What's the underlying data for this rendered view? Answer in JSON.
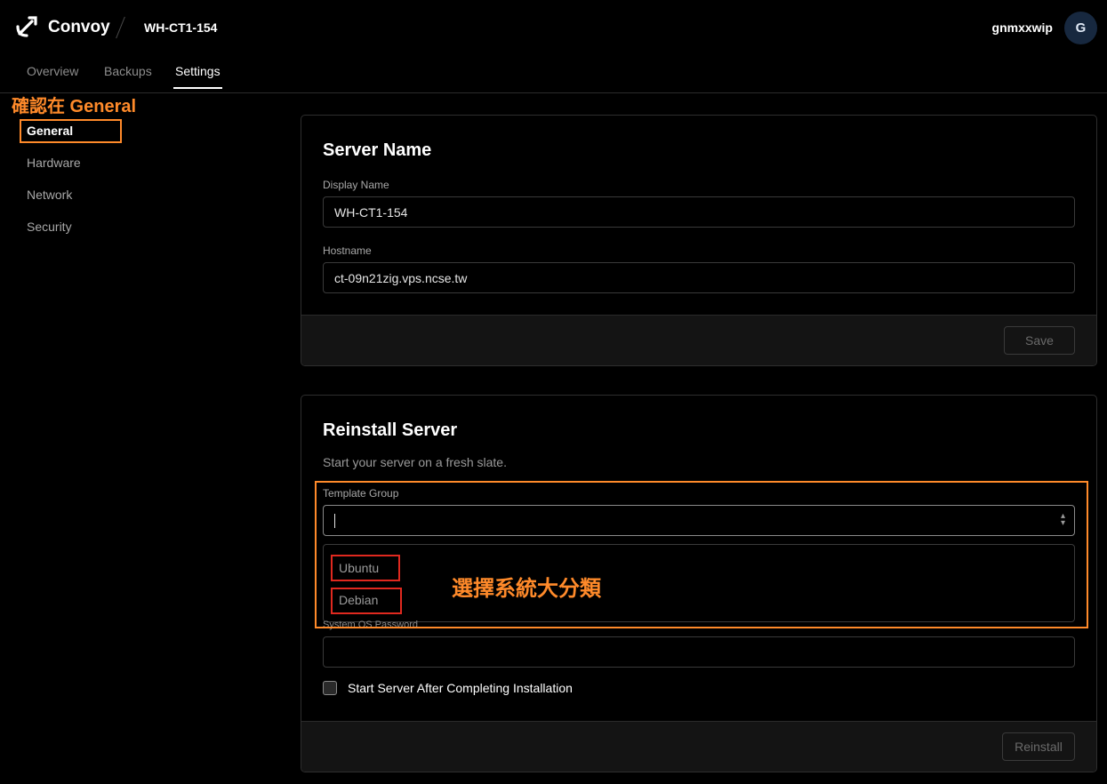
{
  "header": {
    "brand": "Convoy",
    "server_name": "WH-CT1-154",
    "username": "gnmxxwip",
    "avatar_initial": "G"
  },
  "tabs": [
    {
      "label": "Overview",
      "active": false
    },
    {
      "label": "Backups",
      "active": false
    },
    {
      "label": "Settings",
      "active": true
    }
  ],
  "sidebar": {
    "annotation": "確認在 General",
    "items": [
      {
        "label": "General",
        "active": true
      },
      {
        "label": "Hardware",
        "active": false
      },
      {
        "label": "Network",
        "active": false
      },
      {
        "label": "Security",
        "active": false
      }
    ]
  },
  "server_name_card": {
    "title": "Server Name",
    "display_name_label": "Display Name",
    "display_name_value": "WH-CT1-154",
    "hostname_label": "Hostname",
    "hostname_value": "ct-09n21zig.vps.ncse.tw",
    "save_label": "Save"
  },
  "reinstall_card": {
    "title": "Reinstall Server",
    "description": "Start your server on a fresh slate.",
    "template_group_label": "Template Group",
    "template_options": [
      "Ubuntu",
      "Debian"
    ],
    "template_annotation": "選擇系統大分類",
    "password_label": "System OS Password",
    "start_after_label": "Start Server After Completing Installation",
    "reinstall_label": "Reinstall"
  },
  "colors": {
    "annotation_orange": "#ff8a2a",
    "annotation_red": "#e0291f",
    "background": "#000000"
  }
}
